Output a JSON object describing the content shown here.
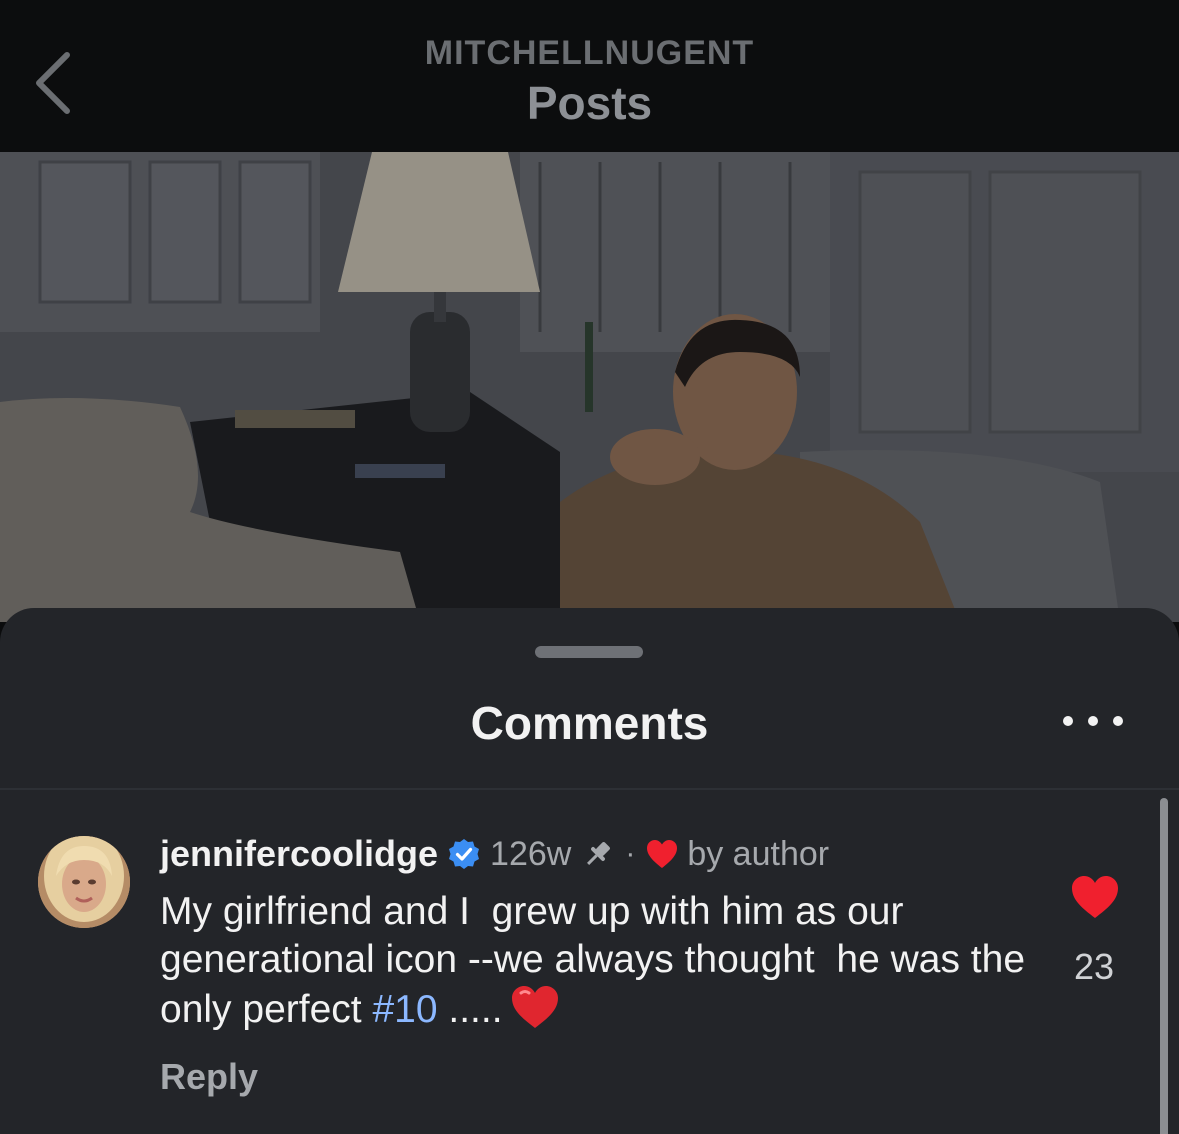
{
  "header": {
    "subtitle": "MITCHELLNUGENT",
    "title": "Posts",
    "back_icon": "chevron-left-icon"
  },
  "post": {
    "image": "photo of a man in a tan jacket seated in a living room beside a lamp"
  },
  "comments_sheet": {
    "title": "Comments",
    "more_icon": "ellipsis-icon",
    "comments": [
      {
        "username": "jennifercoolidge",
        "verified": true,
        "timestamp": "126w",
        "pinned": true,
        "separator": "·",
        "liked_by_author_label": "by author",
        "text_part1": "My girlfriend and I  grew up with him as our generational icon --we always thought  he was the only perfect ",
        "hashtag": "#10",
        "text_part2": " .....",
        "reply_label": "Reply",
        "like_count": "23",
        "colors": {
          "heart": "#f0202e",
          "verified": "#3b8ef3",
          "hashtag": "#8cb8ff"
        }
      }
    ]
  }
}
